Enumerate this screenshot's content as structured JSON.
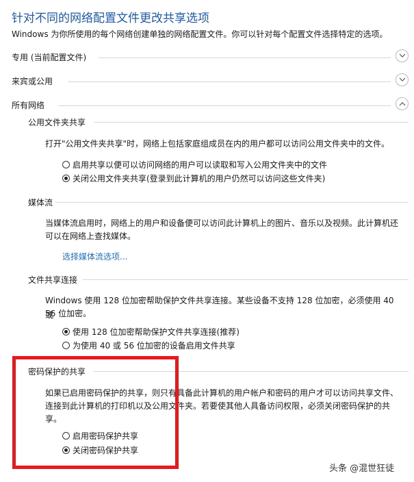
{
  "page": {
    "title": "针对不同的网络配置文件更改共享选项",
    "description": "Windows 为你所使用的每个网络创建单独的网络配置文件。你可以针对每个配置文件选择特定的选项。"
  },
  "profiles": [
    {
      "label": "专用 (当前配置文件)",
      "state": "collapsed"
    },
    {
      "label": "来宾或公用",
      "state": "collapsed"
    },
    {
      "label": "所有网络",
      "state": "expanded"
    }
  ],
  "public_folder": {
    "heading": "公用文件夹共享",
    "description": "打开\"公用文件夹共享\"时，网络上包括家庭组成员在内的用户都可以访问公用文件夹中的文件。",
    "options": [
      {
        "label": "启用共享以便可以访问网络的用户可以读取和写入公用文件夹中的文件",
        "checked": false
      },
      {
        "label": "关闭公用文件夹共享(登录到此计算机的用户仍然可以访问这些文件夹)",
        "checked": true
      }
    ]
  },
  "media": {
    "heading": "媒体流",
    "description_line1": "当媒体流启用时，网络上的用户和设备便可以访问此计算机上的图片、音乐以及视频。此计算机还",
    "description_line2": "可以在网络上查找媒体。",
    "link": "选择媒体流选项..."
  },
  "file_sharing": {
    "heading": "文件共享连接",
    "description_line1": "Windows 使用 128 位加密帮助保护文件共享连接。某些设备不支持 128 位加密，必须使用 40 或",
    "description_line2": "56 位加密。",
    "options": [
      {
        "label": "使用 128 位加密帮助保护文件共享连接(推荐)",
        "checked": true
      },
      {
        "label": "为使用 40 或 56 位加密的设备启用文件共享",
        "checked": false
      }
    ]
  },
  "password": {
    "heading": "密码保护的共享",
    "description_line1": "如果已启用密码保护的共享，则只有具备此计算机的用户帐户和密码的用户才可以访问共享文件、",
    "description_line2": "连接到此计算机的打印机以及公用文件夹。若要使其他人具备访问权限，必须关闭密码保护的共",
    "description_line3": "享。",
    "options": [
      {
        "label": "启用密码保护共享",
        "checked": false
      },
      {
        "label": "关闭密码保护共享",
        "checked": true
      }
    ]
  },
  "watermark": "头条 @混世狂徒",
  "colors": {
    "title": "#1e5aa8",
    "link": "#1e6fc2",
    "highlight_box": "#e8181c"
  },
  "icons": {
    "collapsed": "chevron-down-icon",
    "expanded": "chevron-up-icon"
  }
}
